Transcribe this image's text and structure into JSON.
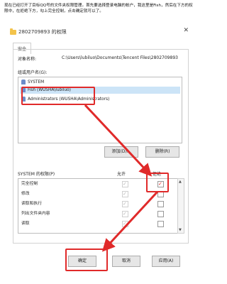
{
  "instruction": "现在已经打开了目标QQ号的文件夹权限管理。首先要选择登录电脑的帐户，我这里是Fish，然后在下方的权限中，在拒绝下方，勾上完全控制，点击确定就可以了。",
  "dialog": {
    "title": "2802709893 的权限",
    "close": "✕",
    "tab": "安全",
    "object_label": "对象名称:",
    "object_value": "C:\\Users\\lubiluo\\Documents\\Tencent Files\\2802709893",
    "group_label": "组或用户名(G):",
    "users": [
      {
        "label": "SYSTEM"
      },
      {
        "label": "Fish (WUSHA\\lubiluo)"
      },
      {
        "label": "Administrators (WUSHA\\Administrators)"
      }
    ],
    "add_button": "添加(D)...",
    "remove_button": "删除(R)",
    "permissions_header": "SYSTEM 的权限(P)",
    "allow_header": "允许",
    "deny_header": "拒绝",
    "permissions": [
      {
        "name": "完全控制"
      },
      {
        "name": "修改"
      },
      {
        "name": "读取和执行"
      },
      {
        "name": "列出文件夹内容"
      },
      {
        "name": "读取"
      }
    ],
    "ok_button": "确定",
    "cancel_button": "取消",
    "apply_button": "应用(A)"
  },
  "colors": {
    "annotation": "#e02a2a",
    "selection": "#cce4f7"
  }
}
